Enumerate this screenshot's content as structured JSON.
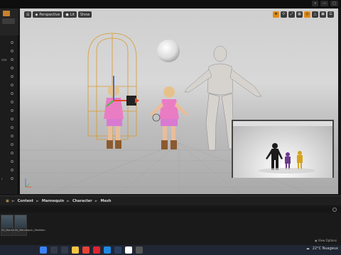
{
  "window": {
    "top_right_labels": [
      "»",
      "—",
      "□"
    ]
  },
  "left_panel": {
    "rows": [
      "",
      "",
      "cter",
      "",
      "",
      "",
      "",
      "",
      "",
      "",
      "",
      "",
      "",
      "",
      "",
      "",
      "r"
    ]
  },
  "viewport": {
    "toolbar": {
      "perspective_label": "Perspective",
      "lit_label": "Lit",
      "show_label": "Show"
    },
    "right_tools": [
      "✥",
      "⟳",
      "⤢",
      "▦",
      "◎",
      "△",
      "▣",
      "☰"
    ],
    "preview": {
      "label": ""
    }
  },
  "breadcrumb": {
    "items": [
      "Content",
      "Mannequin",
      "Character",
      "Mesh"
    ]
  },
  "assets": [
    {
      "label": "SK_Mannequin"
    },
    {
      "label": "SK_Mannequin_Skeleton"
    }
  ],
  "view_options_label": "View Options",
  "taskbar": {
    "weather": "22°C  Nuageux",
    "icons": [
      {
        "name": "windows-start-icon",
        "color": "#3b82f6"
      },
      {
        "name": "search-icon",
        "color": "#333b48"
      },
      {
        "name": "taskview-icon",
        "color": "#333b48"
      },
      {
        "name": "file-explorer-icon",
        "color": "#f5c542"
      },
      {
        "name": "chrome-icon",
        "color": "#e94235"
      },
      {
        "name": "opera-icon",
        "color": "#e0222f"
      },
      {
        "name": "photoshop-icon",
        "color": "#1e88e5"
      },
      {
        "name": "steam-icon",
        "color": "#2a3f5f"
      },
      {
        "name": "unreal-icon",
        "color": "#ffffff"
      },
      {
        "name": "app-icon",
        "color": "#555"
      }
    ]
  },
  "colors": {
    "gizmo_orange": "#e08a16",
    "selection_yellow": "#d89a2a"
  }
}
